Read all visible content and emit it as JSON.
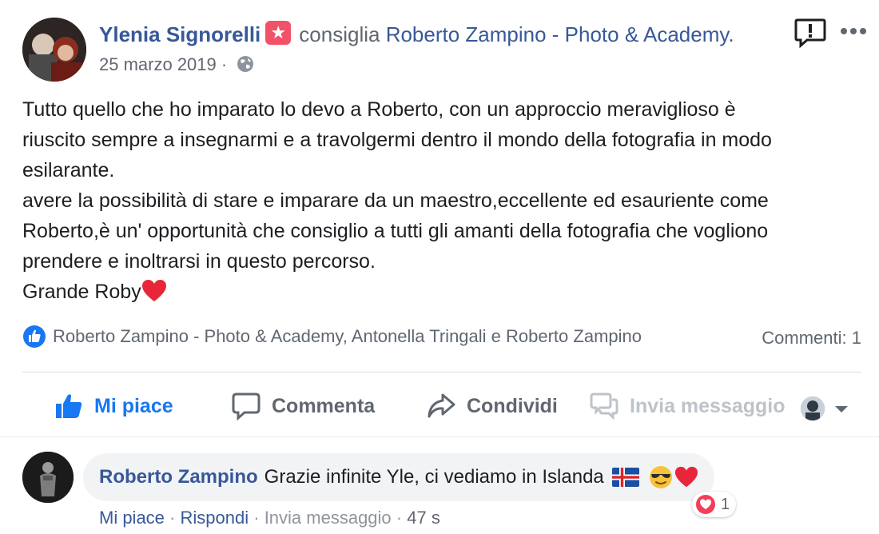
{
  "post": {
    "author": "Ylenia Signorelli",
    "recommends_text": "consiglia",
    "page_name": "Roberto Zampino - Photo & Academy.",
    "date": "25 marzo 2019",
    "separator": "·",
    "body": "Tutto quello che ho imparato lo devo a Roberto, con un approccio meraviglioso è\nriuscito sempre a insegnarmi e a travolgermi dentro il mondo della fotografia in modo\nesilarante.\navere la possibilità di stare e imparare da un maestro,eccellente ed esauriente come\nRoberto,è un' opportunità che consiglio a tutti gli amanti della fotografia che vogliono\nprendere e inoltrarsi in questo percorso.\nGrande Roby",
    "reactions_text": "Roberto Zampino - Photo & Academy, Antonella Tringali e Roberto Zampino",
    "comments_count": "Commenti: 1"
  },
  "actions": {
    "like": "Mi piace",
    "comment": "Commenta",
    "share": "Condividi",
    "message": "Invia messaggio"
  },
  "comment": {
    "author": "Roberto Zampino",
    "text": "Grazie infinite Yle, ci vediamo in Islanda",
    "reaction_count": "1",
    "like_link": "Mi piace",
    "reply_link": "Rispondi",
    "message_link": "Invia messaggio",
    "time": "47 s",
    "dot": "·"
  },
  "colors": {
    "link_blue": "#385898",
    "like_blue": "#1877f2",
    "muted": "#606770",
    "badge_pink": "#f25268",
    "heart_red": "#e8263a"
  },
  "icons": [
    "star-badge-icon",
    "globe-icon",
    "report-icon",
    "more-icon",
    "like-badge-icon",
    "thumbs-up-icon",
    "comment-icon",
    "share-icon",
    "messenger-icon",
    "caret-down-icon",
    "heart-icon",
    "iceland-flag-icon",
    "cool-face-icon"
  ]
}
